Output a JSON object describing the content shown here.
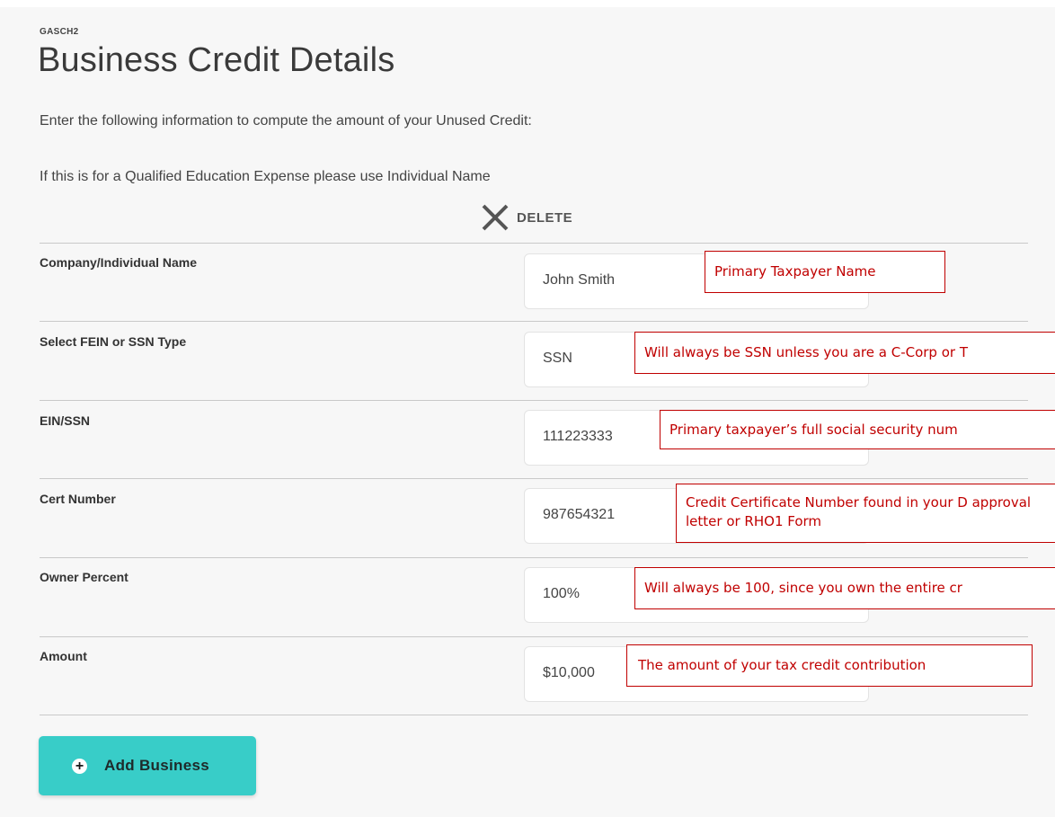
{
  "header": {
    "form_id": "GASCH2",
    "title": "Business Credit Details"
  },
  "intro": {
    "line1": "Enter the following information to compute the amount of your Unused Credit:",
    "line2": "If this is for a Qualified Education Expense please use Individual Name"
  },
  "delete": {
    "label": "DELETE",
    "icon": "close-icon"
  },
  "fields": {
    "name": {
      "label": "Company/Individual Name",
      "value": "John Smith"
    },
    "id_type": {
      "label": "Select FEIN or SSN Type",
      "value": "SSN"
    },
    "ssn": {
      "label": "EIN/SSN",
      "value": "111223333"
    },
    "cert": {
      "label": "Cert Number",
      "value": "987654321"
    },
    "owner": {
      "label": "Owner Percent",
      "value": "100%"
    },
    "amount": {
      "label": "Amount",
      "value": "$10,000"
    }
  },
  "callouts": {
    "name": "Primary Taxpayer Name",
    "id_type": "Will always be SSN unless you are a C-Corp or T",
    "ssn": "Primary taxpayer’s full social security num",
    "cert": "Credit Certificate Number found in your D approval letter or RHO1 Form",
    "owner": "Will always be 100, since you own the entire cr",
    "amount": "The amount of your tax credit contribution"
  },
  "add_business": {
    "label": "Add Business",
    "icon": "plus-circle-icon"
  },
  "colors": {
    "accent": "#38cdc8",
    "callout_red": "#c00000",
    "background": "#f7f7f7"
  }
}
